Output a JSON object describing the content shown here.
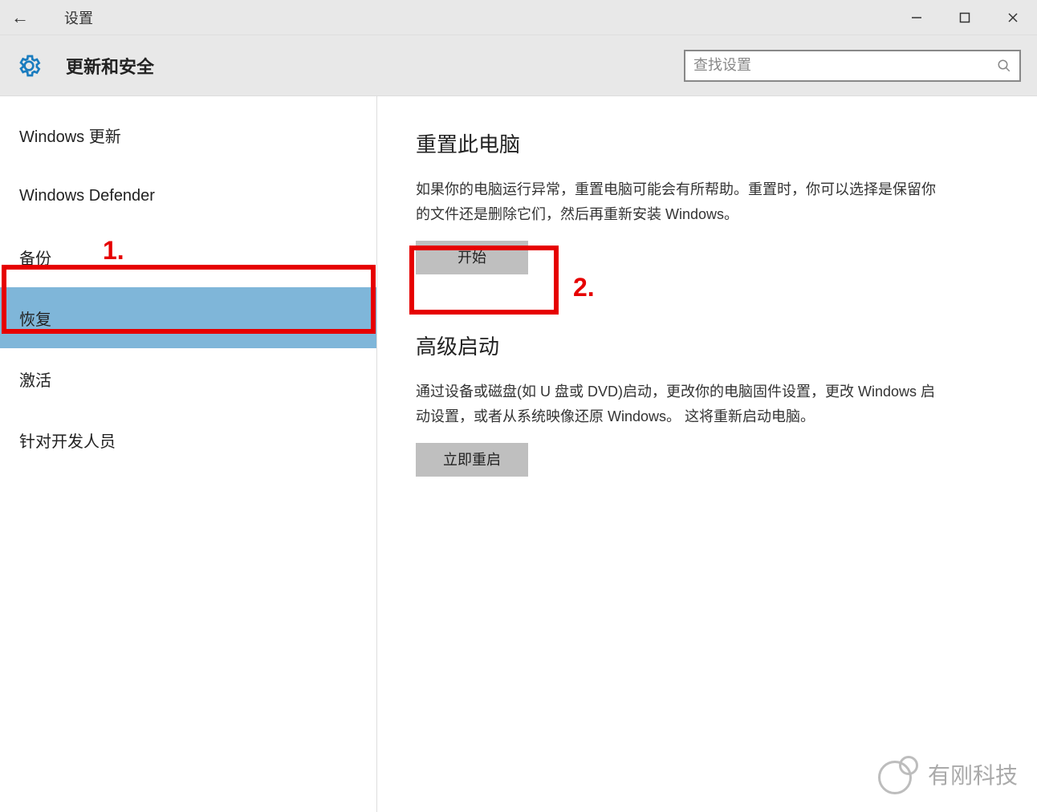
{
  "window": {
    "title": "设置",
    "controls": {
      "minimize": "–",
      "maximize": "☐",
      "close": "✕"
    },
    "back_glyph": "←"
  },
  "header": {
    "heading": "更新和安全",
    "search_placeholder": "查找设置"
  },
  "sidebar": {
    "items": [
      {
        "label": "Windows 更新"
      },
      {
        "label": "Windows Defender"
      },
      {
        "label": "备份"
      },
      {
        "label": "恢复",
        "selected": true
      },
      {
        "label": "激活"
      },
      {
        "label": "针对开发人员"
      }
    ]
  },
  "main": {
    "reset": {
      "title": "重置此电脑",
      "desc": "如果你的电脑运行异常，重置电脑可能会有所帮助。重置时，你可以选择是保留你的文件还是删除它们，然后再重新安装 Windows。",
      "button": "开始"
    },
    "advanced": {
      "title": "高级启动",
      "desc": "通过设备或磁盘(如 U 盘或 DVD)启动，更改你的电脑固件设置，更改 Windows 启动设置，或者从系统映像还原 Windows。  这将重新启动电脑。",
      "button": "立即重启"
    }
  },
  "annotations": {
    "label1": "1.",
    "label2": "2."
  },
  "watermark": {
    "text": "有刚科技"
  }
}
